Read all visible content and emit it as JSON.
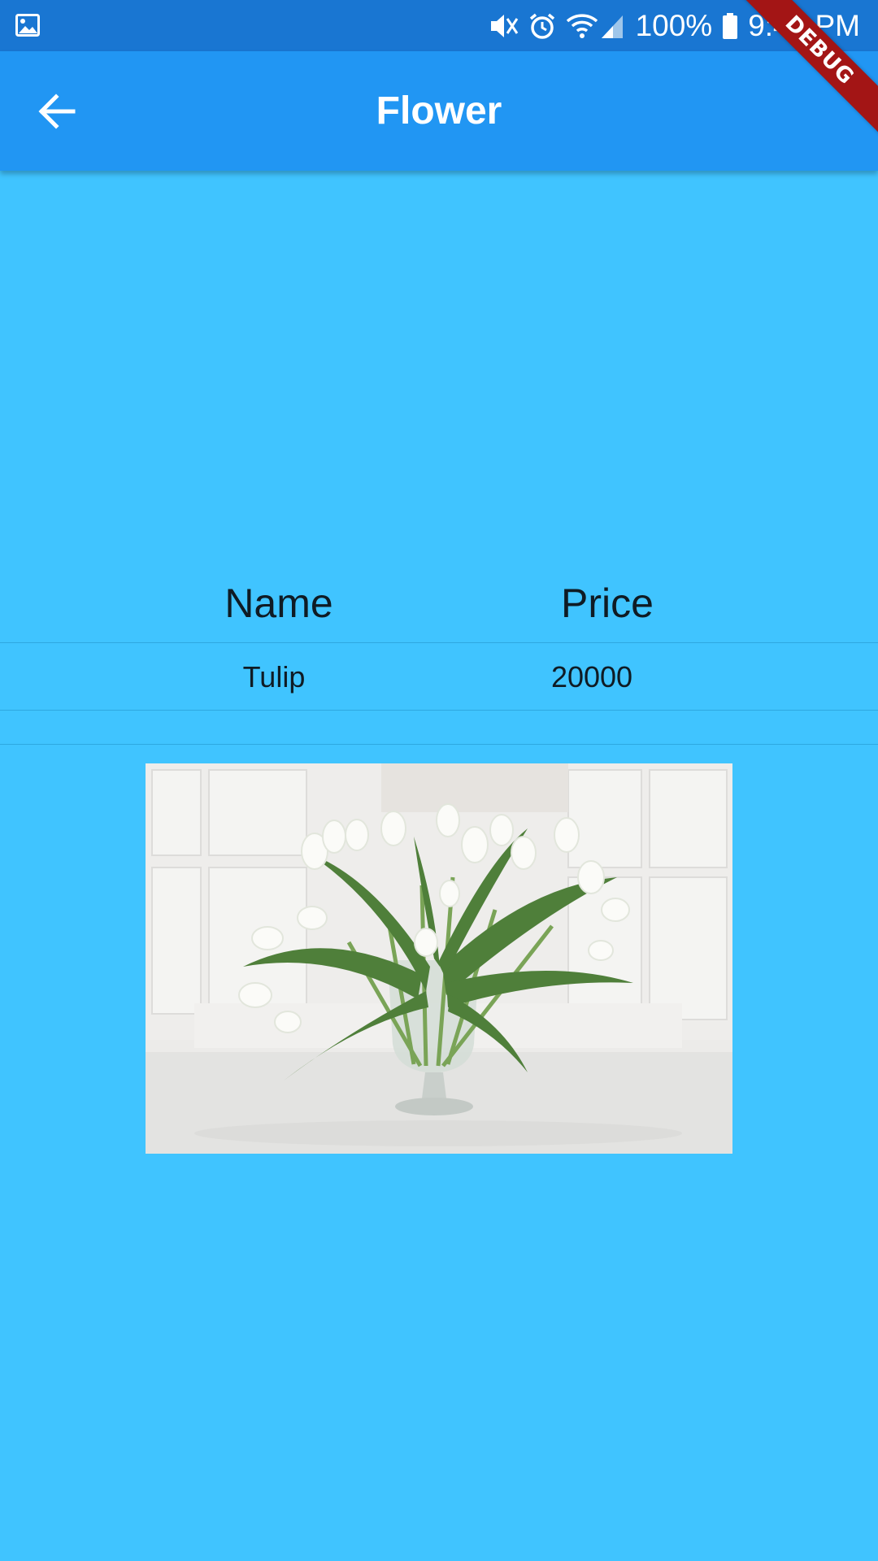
{
  "status_bar": {
    "battery": "100%",
    "time": "9:44 PM",
    "icons": [
      "gallery-icon",
      "mute-icon",
      "alarm-icon",
      "wifi-icon",
      "signal-icon",
      "battery-icon"
    ]
  },
  "app_bar": {
    "title": "Flower",
    "back_icon": "arrow-back-icon",
    "background": "#2196f3"
  },
  "debug_banner": "DEBUG",
  "table": {
    "columns": [
      "Name",
      "Price"
    ],
    "rows": [
      [
        "Tulip",
        "20000"
      ]
    ]
  },
  "colors": {
    "screen_background": "#40c4ff",
    "status_bar": "#1976d2",
    "banner": "#a31515"
  }
}
